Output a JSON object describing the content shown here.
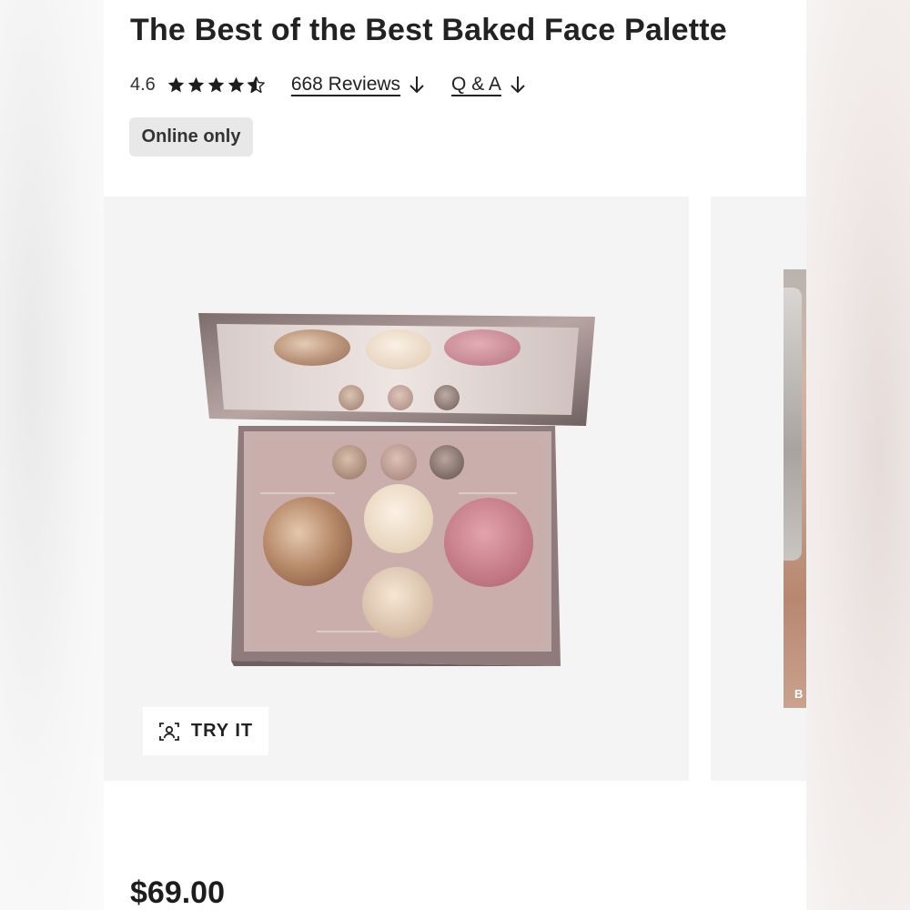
{
  "product": {
    "title": "The Best of the Best Baked Face Palette",
    "rating_value": "4.6",
    "rating": 4.6,
    "rating_max": 5,
    "reviews_label": "668 Reviews",
    "qa_label": "Q & A",
    "badge": "Online only",
    "price": "$69.00"
  },
  "gallery": {
    "try_label": "TRY IT",
    "next_image_label": "B"
  },
  "colors": {
    "text": "#222222",
    "badge_bg": "#e8e8e8",
    "gallery_bg": "#f4f4f4"
  },
  "icons": [
    "star-icon",
    "half-star-icon",
    "arrow-down-icon",
    "face-scan-icon"
  ]
}
